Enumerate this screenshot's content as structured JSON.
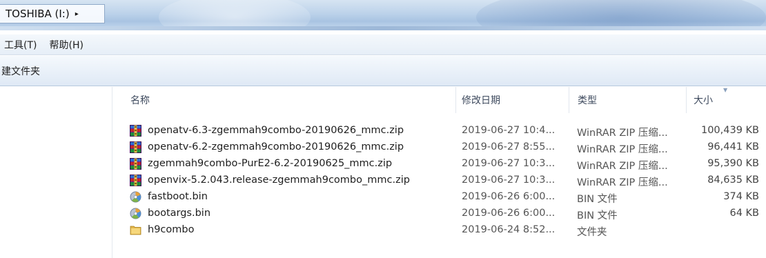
{
  "address_bar": {
    "breadcrumb": "TOSHIBA (I:)",
    "arrow": "▸"
  },
  "menu": [
    "工具(T)",
    "帮助(H)"
  ],
  "toolbar": {
    "new_folder_label": "建文件夹"
  },
  "columns": {
    "name": "名称",
    "date": "修改日期",
    "type": "类型",
    "size": "大小"
  },
  "files": [
    {
      "icon": "winrar-archive-icon",
      "name": "openatv-6.3-zgemmah9combo-20190626_mmc.zip",
      "date": "2019-06-27 10:4...",
      "type": "WinRAR ZIP 压缩...",
      "size": "100,439 KB"
    },
    {
      "icon": "winrar-archive-icon",
      "name": "openatv-6.2-zgemmah9combo-20190626_mmc.zip",
      "date": "2019-06-27 8:55...",
      "type": "WinRAR ZIP 压缩...",
      "size": "96,441 KB"
    },
    {
      "icon": "winrar-archive-icon",
      "name": "zgemmah9combo-PurE2-6.2-20190625_mmc.zip",
      "date": "2019-06-27 10:3...",
      "type": "WinRAR ZIP 压缩...",
      "size": "95,390 KB"
    },
    {
      "icon": "winrar-archive-icon",
      "name": "openvix-5.2.043.release-zgemmah9combo_mmc.zip",
      "date": "2019-06-27 10:3...",
      "type": "WinRAR ZIP 压缩...",
      "size": "84,635 KB"
    },
    {
      "icon": "bin-file-icon",
      "name": "fastboot.bin",
      "date": "2019-06-26 6:00...",
      "type": "BIN 文件",
      "size": "374 KB"
    },
    {
      "icon": "bin-file-icon",
      "name": "bootargs.bin",
      "date": "2019-06-26 6:00...",
      "type": "BIN 文件",
      "size": "64 KB"
    },
    {
      "icon": "folder-icon",
      "name": "h9combo",
      "date": "2019-06-24 8:52...",
      "type": "文件夹",
      "size": ""
    }
  ]
}
